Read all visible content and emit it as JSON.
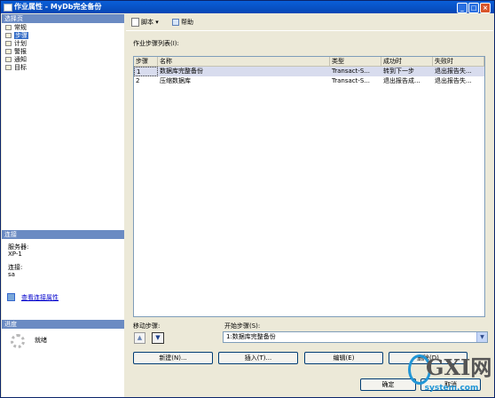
{
  "window": {
    "title": "作业属性 - MyDb完全备份",
    "minimize": "_",
    "maximize": "□",
    "close": "×"
  },
  "left": {
    "pages_header": "选择页",
    "pages": [
      {
        "label": "常规",
        "selected": false
      },
      {
        "label": "步骤",
        "selected": true
      },
      {
        "label": "计划",
        "selected": false
      },
      {
        "label": "警报",
        "selected": false
      },
      {
        "label": "通知",
        "selected": false
      },
      {
        "label": "目标",
        "selected": false
      }
    ],
    "connection_header": "连接",
    "server_label": "服务器:",
    "server_value": "XP-1",
    "connection_label": "连接:",
    "connection_value": "sa",
    "view_connection_link": "查看连接属性",
    "progress_header": "进度",
    "progress_status": "就绪"
  },
  "toolbar": {
    "script_label": "脚本 ▾",
    "help_label": "帮助",
    "script_icon": "script-icon",
    "help_icon": "help-icon"
  },
  "steps": {
    "list_label": "作业步骤列表(I):",
    "columns": [
      "步骤",
      "名称",
      "类型",
      "成功时",
      "失败时"
    ],
    "rows": [
      [
        "1",
        "数据库完整备份",
        "Transact-S...",
        "转到下一步",
        "退出报告失..."
      ],
      [
        "2",
        "压缩数据库",
        "Transact-S...",
        "退出报告成...",
        "退出报告失..."
      ]
    ],
    "move_label": "移动步骤:",
    "move_up_icon": "arrow-up-icon",
    "move_down_icon": "arrow-down-icon",
    "start_label": "开始步骤(S):",
    "start_value": "1:数据库完整备份"
  },
  "buttons": {
    "new": "新建(N)...",
    "insert": "插入(T)...",
    "edit": "编辑(E)",
    "delete": "删除(D)",
    "ok": "确定",
    "cancel": "取消"
  },
  "watermark": {
    "main": "GXI网",
    "sub": "system.com"
  },
  "colors": {
    "titlebar": "#0a5fd8",
    "section_header": "#6b8bc3",
    "selection": "#316ac5",
    "row_highlight": "#d8dcee",
    "watermark_blue": "#2196d6"
  }
}
